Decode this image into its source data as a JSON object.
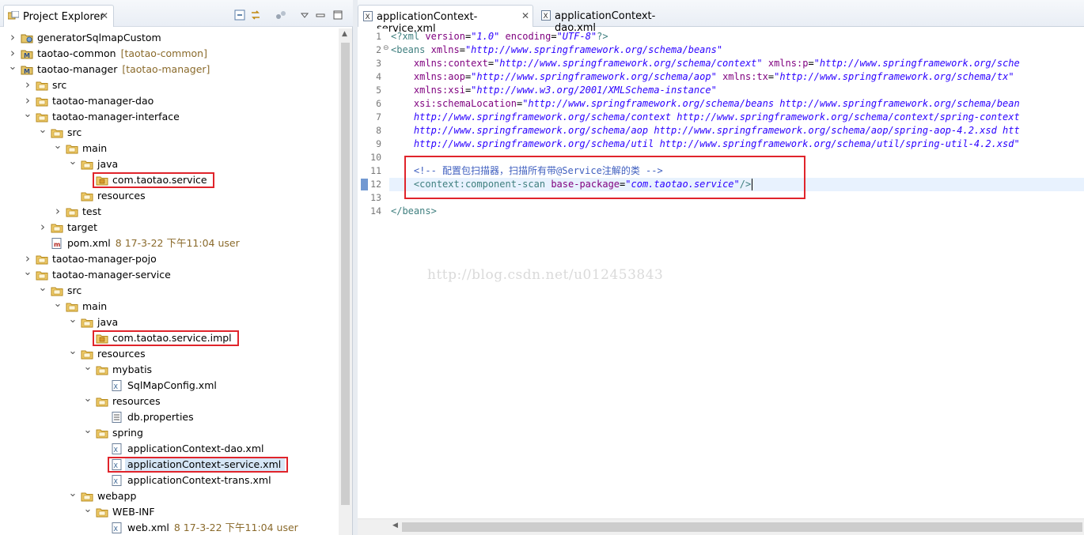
{
  "explorer": {
    "tab_label": "Project Explorer",
    "close_glyph": "✕",
    "toolbar_icons": [
      "collapse-all-icon",
      "link-with-editor-icon",
      "group-icon",
      "view-menu-icon",
      "minimize-icon",
      "maximize-icon"
    ],
    "items": [
      {
        "label": "generatorSqlmapCustom",
        "extra": "",
        "depth": 0,
        "twisty": "collapsed",
        "icon": "project-icon"
      },
      {
        "label": "taotao-common",
        "extra": "[taotao-common]",
        "depth": 0,
        "twisty": "collapsed",
        "icon": "maven-project-icon"
      },
      {
        "label": "taotao-manager",
        "extra": "[taotao-manager]",
        "depth": 0,
        "twisty": "expanded",
        "icon": "maven-project-icon"
      },
      {
        "label": "src",
        "extra": "",
        "depth": 1,
        "twisty": "collapsed",
        "icon": "folder-icon"
      },
      {
        "label": "taotao-manager-dao",
        "extra": "",
        "depth": 1,
        "twisty": "collapsed",
        "icon": "folder-icon"
      },
      {
        "label": "taotao-manager-interface",
        "extra": "",
        "depth": 1,
        "twisty": "expanded",
        "icon": "folder-icon"
      },
      {
        "label": "src",
        "extra": "",
        "depth": 2,
        "twisty": "expanded",
        "icon": "folder-icon"
      },
      {
        "label": "main",
        "extra": "",
        "depth": 3,
        "twisty": "expanded",
        "icon": "folder-icon"
      },
      {
        "label": "java",
        "extra": "",
        "depth": 4,
        "twisty": "expanded",
        "icon": "folder-icon"
      },
      {
        "label": "com.taotao.service",
        "extra": "",
        "depth": 5,
        "twisty": "none",
        "icon": "package-folder-icon",
        "highlight": true
      },
      {
        "label": "resources",
        "extra": "",
        "depth": 4,
        "twisty": "none",
        "icon": "folder-icon"
      },
      {
        "label": "test",
        "extra": "",
        "depth": 3,
        "twisty": "collapsed",
        "icon": "folder-icon"
      },
      {
        "label": "target",
        "extra": "",
        "depth": 2,
        "twisty": "collapsed",
        "icon": "folder-icon"
      },
      {
        "label": "pom.xml",
        "extra": "8  17-3-22 下午11:04  user",
        "depth": 2,
        "twisty": "none",
        "icon": "maven-pom-icon"
      },
      {
        "label": "taotao-manager-pojo",
        "extra": "",
        "depth": 1,
        "twisty": "collapsed",
        "icon": "folder-icon"
      },
      {
        "label": "taotao-manager-service",
        "extra": "",
        "depth": 1,
        "twisty": "expanded",
        "icon": "folder-icon"
      },
      {
        "label": "src",
        "extra": "",
        "depth": 2,
        "twisty": "expanded",
        "icon": "folder-icon"
      },
      {
        "label": "main",
        "extra": "",
        "depth": 3,
        "twisty": "expanded",
        "icon": "folder-icon"
      },
      {
        "label": "java",
        "extra": "",
        "depth": 4,
        "twisty": "expanded",
        "icon": "folder-icon"
      },
      {
        "label": "com.taotao.service.impl",
        "extra": "",
        "depth": 5,
        "twisty": "none",
        "icon": "package-folder-icon",
        "highlight": true
      },
      {
        "label": "resources",
        "extra": "",
        "depth": 4,
        "twisty": "expanded",
        "icon": "folder-icon"
      },
      {
        "label": "mybatis",
        "extra": "",
        "depth": 5,
        "twisty": "expanded",
        "icon": "folder-icon"
      },
      {
        "label": "SqlMapConfig.xml",
        "extra": "",
        "depth": 6,
        "twisty": "none",
        "icon": "xml-file-icon"
      },
      {
        "label": "resources",
        "extra": "",
        "depth": 5,
        "twisty": "expanded",
        "icon": "folder-icon"
      },
      {
        "label": "db.properties",
        "extra": "",
        "depth": 6,
        "twisty": "none",
        "icon": "properties-file-icon"
      },
      {
        "label": "spring",
        "extra": "",
        "depth": 5,
        "twisty": "expanded",
        "icon": "folder-icon"
      },
      {
        "label": "applicationContext-dao.xml",
        "extra": "",
        "depth": 6,
        "twisty": "none",
        "icon": "xml-file-icon"
      },
      {
        "label": "applicationContext-service.xml",
        "extra": "",
        "depth": 6,
        "twisty": "none",
        "icon": "xml-file-icon",
        "highlight": true,
        "selected": true
      },
      {
        "label": "applicationContext-trans.xml",
        "extra": "",
        "depth": 6,
        "twisty": "none",
        "icon": "xml-file-icon"
      },
      {
        "label": "webapp",
        "extra": "",
        "depth": 4,
        "twisty": "expanded",
        "icon": "folder-icon"
      },
      {
        "label": "WEB-INF",
        "extra": "",
        "depth": 5,
        "twisty": "expanded",
        "icon": "folder-icon"
      },
      {
        "label": "web.xml",
        "extra": "8  17-3-22 下午11:04  user",
        "depth": 6,
        "twisty": "none",
        "icon": "xml-file-icon"
      }
    ]
  },
  "editor": {
    "tabs": [
      {
        "label": "applicationContext-service.xml",
        "active": true,
        "close_glyph": "✕"
      },
      {
        "label": "applicationContext-dao.xml",
        "active": false
      }
    ],
    "current_line": 12,
    "lines": [
      {
        "n": "1",
        "tokens": [
          [
            "pun",
            "<?"
          ],
          [
            "tag",
            "xml"
          ],
          [
            "txt",
            " "
          ],
          [
            "attr",
            "version"
          ],
          [
            "txt",
            "="
          ],
          [
            "val",
            "\"1.0\""
          ],
          [
            "txt",
            " "
          ],
          [
            "attr",
            "encoding"
          ],
          [
            "txt",
            "="
          ],
          [
            "val",
            "\"UTF-8\""
          ],
          [
            "pun",
            "?>"
          ]
        ]
      },
      {
        "n": "2",
        "fold": true,
        "tokens": [
          [
            "pun",
            "<"
          ],
          [
            "tag",
            "beans"
          ],
          [
            "txt",
            " "
          ],
          [
            "attr",
            "xmlns"
          ],
          [
            "txt",
            "="
          ],
          [
            "val",
            "\"http://www.springframework.org/schema/beans\""
          ]
        ]
      },
      {
        "n": "3",
        "tokens": [
          [
            "txt",
            "    "
          ],
          [
            "attr",
            "xmlns:context"
          ],
          [
            "txt",
            "="
          ],
          [
            "val",
            "\"http://www.springframework.org/schema/context\""
          ],
          [
            "txt",
            " "
          ],
          [
            "attr",
            "xmlns:p"
          ],
          [
            "txt",
            "="
          ],
          [
            "val",
            "\"http://www.springframework.org/sche"
          ]
        ]
      },
      {
        "n": "4",
        "tokens": [
          [
            "txt",
            "    "
          ],
          [
            "attr",
            "xmlns:aop"
          ],
          [
            "txt",
            "="
          ],
          [
            "val",
            "\"http://www.springframework.org/schema/aop\""
          ],
          [
            "txt",
            " "
          ],
          [
            "attr",
            "xmlns:tx"
          ],
          [
            "txt",
            "="
          ],
          [
            "val",
            "\"http://www.springframework.org/schema/tx\""
          ]
        ]
      },
      {
        "n": "5",
        "tokens": [
          [
            "txt",
            "    "
          ],
          [
            "attr",
            "xmlns:xsi"
          ],
          [
            "txt",
            "="
          ],
          [
            "val",
            "\"http://www.w3.org/2001/XMLSchema-instance\""
          ]
        ]
      },
      {
        "n": "6",
        "tokens": [
          [
            "txt",
            "    "
          ],
          [
            "attr",
            "xsi:schemaLocation"
          ],
          [
            "txt",
            "="
          ],
          [
            "val",
            "\"http://www.springframework.org/schema/beans http://www.springframework.org/schema/bean"
          ]
        ]
      },
      {
        "n": "7",
        "tokens": [
          [
            "txt",
            "    "
          ],
          [
            "val",
            "http://www.springframework.org/schema/context http://www.springframework.org/schema/context/spring-context"
          ]
        ]
      },
      {
        "n": "8",
        "tokens": [
          [
            "txt",
            "    "
          ],
          [
            "val",
            "http://www.springframework.org/schema/aop http://www.springframework.org/schema/aop/spring-aop-4.2.xsd htt"
          ]
        ]
      },
      {
        "n": "9",
        "tokens": [
          [
            "txt",
            "    "
          ],
          [
            "val",
            "http://www.springframework.org/schema/util http://www.springframework.org/schema/util/spring-util-4.2.xsd\""
          ]
        ]
      },
      {
        "n": "10",
        "tokens": []
      },
      {
        "n": "11",
        "tokens": [
          [
            "txt",
            "    "
          ],
          [
            "cmt",
            "<!-- 配置包扫描器，扫描所有带@Service注解的类 -->"
          ]
        ]
      },
      {
        "n": "12",
        "tokens": [
          [
            "txt",
            "    "
          ],
          [
            "pun",
            "<"
          ],
          [
            "tag",
            "context:component-scan"
          ],
          [
            "txt",
            " "
          ],
          [
            "attr",
            "base-package"
          ],
          [
            "txt",
            "="
          ],
          [
            "val",
            "\"com.taotao.service\""
          ],
          [
            "pun",
            "/>"
          ]
        ]
      },
      {
        "n": "13",
        "tokens": []
      },
      {
        "n": "14",
        "tokens": [
          [
            "pun",
            "</"
          ],
          [
            "tag",
            "beans"
          ],
          [
            "pun",
            ">"
          ]
        ]
      }
    ]
  },
  "watermark": "http://blog.csdn.net/u012453843"
}
